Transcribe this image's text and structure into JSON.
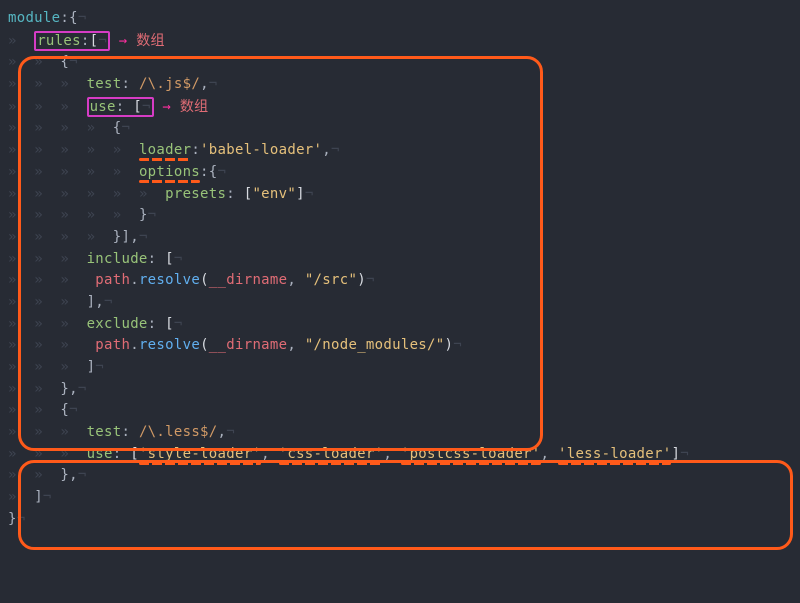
{
  "annotation_cn": "数组",
  "arrow": "→",
  "ws_ind": "»  ",
  "ws_eol": "¬",
  "code": {
    "l1_module": "module",
    "l1_rest": ":{",
    "l2_rules": "rules",
    "l2_after": ":",
    "l2_br": "[",
    "l3_brace": "{",
    "l4_test": "test",
    "l4_colon": ": ",
    "l4_regex": "/\\.js$/",
    "l4_comma": ",",
    "l5_use": "use",
    "l5_colon": ": ",
    "l5_br": "[",
    "l6_brace": "{",
    "l7_loader": "loader",
    "l7_colon": ":",
    "l7_val": "'babel-loader'",
    "l7_comma": ",",
    "l8_options": "options",
    "l8_colon": ":",
    "l8_brace": "{",
    "l9_presets": "presets",
    "l9_colon": ": ",
    "l9_br": "[",
    "l9_val": "\"env\"",
    "l9_close": "]",
    "l10_brace": "}",
    "l11_close": "}],",
    "l12_include": "include",
    "l12_colon": ": ",
    "l12_br": "[",
    "l13_path": "path",
    "l13_dot": ".",
    "l13_resolve": "resolve",
    "l13_open": "(",
    "l13_dirname": "__dirname",
    "l13_comma": ", ",
    "l13_src": "\"/src\"",
    "l13_close": ")",
    "l14_close": "],",
    "l15_exclude": "exclude",
    "l15_colon": ": ",
    "l15_br": "[",
    "l16_path": "path",
    "l16_dot": ".",
    "l16_resolve": "resolve",
    "l16_open": "(",
    "l16_dirname": "__dirname",
    "l16_comma": ", ",
    "l16_nm": "\"/node_modules/\"",
    "l16_close": ")",
    "l17_close": "]",
    "l18_close": "},",
    "l19_brace": "{",
    "l20_test": "test",
    "l20_colon": ": ",
    "l20_regex": "/\\.less$/",
    "l20_comma": ",",
    "l21_use": "use",
    "l21_colon": ": ",
    "l21_br": "[",
    "l21_v1": "'style-loader'",
    "l21_c": ", ",
    "l21_v2": "'css-loader'",
    "l21_v3": "'postcss-loader'",
    "l21_v4": "'less-loader'",
    "l21_close": "]",
    "l22_close": "},",
    "l23_close": "]",
    "l24_close": "}"
  }
}
